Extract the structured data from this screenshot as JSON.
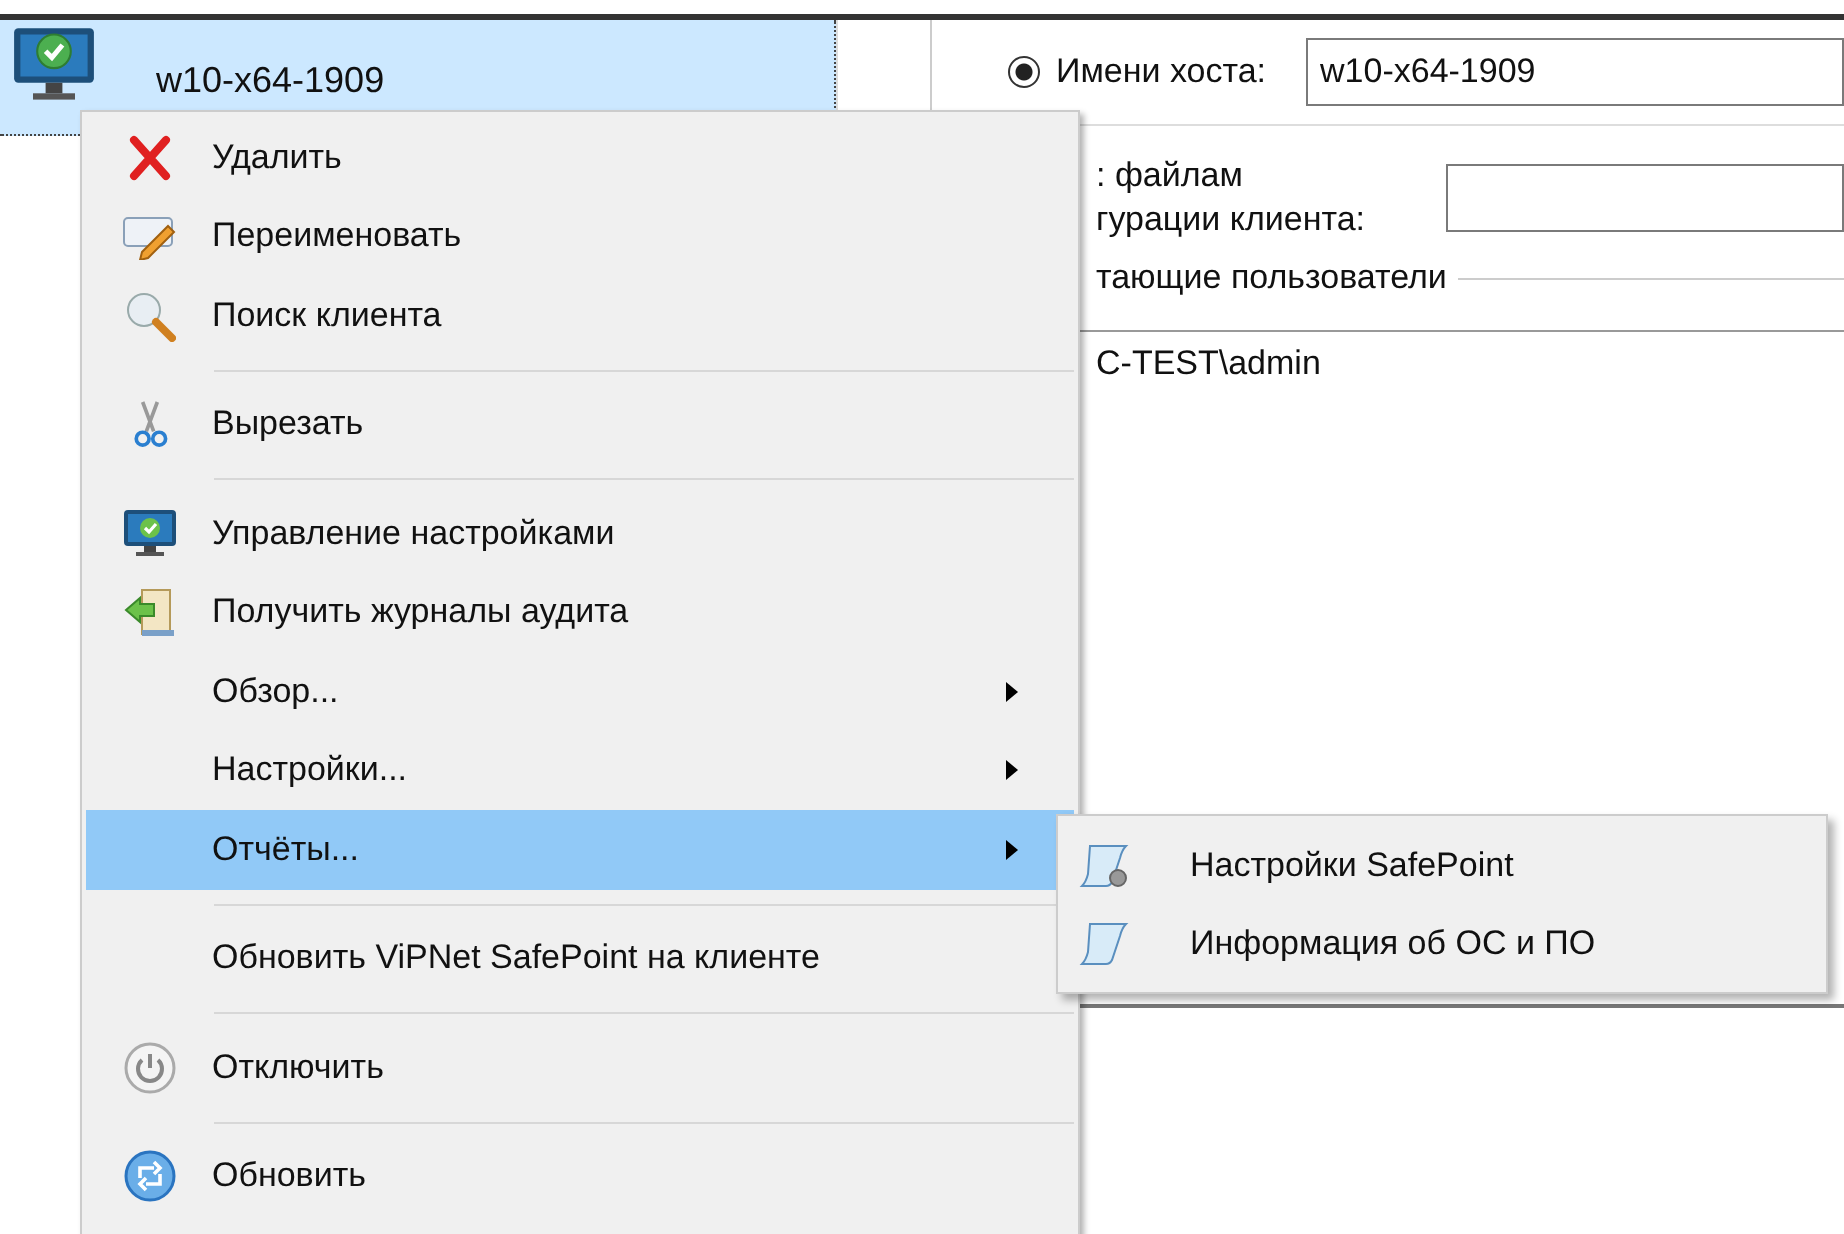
{
  "tree": {
    "items": [
      {
        "label": "w10-x64-1909",
        "selected": true
      }
    ]
  },
  "details": {
    "hostname_option": {
      "label": "Имени хоста:",
      "selected": true,
      "value": "w10-x64-1909"
    },
    "config_path": {
      "label_lines": [
        ": файлам",
        "гурации клиента:"
      ]
    },
    "users_group": {
      "title": "тающие пользователи",
      "users": [
        "C-TEST\\admin"
      ]
    }
  },
  "context_menu": {
    "groups": [
      [
        {
          "label": "Удалить",
          "has_submenu": false,
          "selected": false
        },
        {
          "label": "Переименовать",
          "has_submenu": false,
          "selected": false
        },
        {
          "label": "Поиск клиента",
          "has_submenu": false,
          "selected": false
        }
      ],
      [
        {
          "label": "Вырезать",
          "has_submenu": false,
          "selected": false
        }
      ],
      [
        {
          "label": "Управление настройками",
          "has_submenu": false,
          "selected": false
        },
        {
          "label": "Получить журналы аудита",
          "has_submenu": false,
          "selected": false
        },
        {
          "label": "Обзор...",
          "has_submenu": true,
          "selected": false
        },
        {
          "label": "Настройки...",
          "has_submenu": true,
          "selected": false
        },
        {
          "label": "Отчёты...",
          "has_submenu": true,
          "selected": true
        }
      ],
      [
        {
          "label": "Обновить ViPNet SafePoint на клиенте",
          "has_submenu": false,
          "selected": false
        }
      ],
      [
        {
          "label": "Отключить",
          "has_submenu": false,
          "selected": false
        }
      ],
      [
        {
          "label": "Обновить",
          "has_submenu": false,
          "selected": false
        }
      ]
    ]
  },
  "submenu": {
    "items": [
      {
        "label": "Настройки SafePoint"
      },
      {
        "label": "Информация об ОС и ПО"
      }
    ]
  }
}
